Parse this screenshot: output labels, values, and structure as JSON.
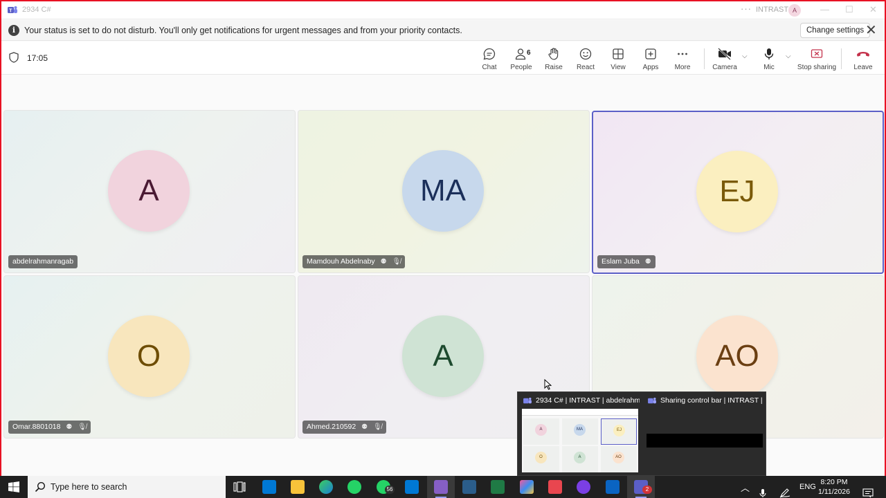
{
  "window": {
    "title": "2934 C#",
    "org": "INTRAST",
    "avatar_initial": "A"
  },
  "banner": {
    "message": "Your status is set to do not disturb. You'll only get notifications for urgent messages and from your priority contacts.",
    "change_settings": "Change settings"
  },
  "toolbar": {
    "timer": "17:05",
    "chat": "Chat",
    "people": "People",
    "people_count": "6",
    "raise": "Raise",
    "react": "React",
    "view": "View",
    "apps": "Apps",
    "more": "More",
    "camera": "Camera",
    "mic": "Mic",
    "stop_sharing": "Stop sharing",
    "leave": "Leave"
  },
  "participants": [
    {
      "initials": "A",
      "name": "abdelrahmanragab",
      "bg": "#f1d3dd",
      "fg": "#4a1a33"
    },
    {
      "initials": "MA",
      "name": "Mamdouh Abdelnaby",
      "bg": "#c7d8ec",
      "fg": "#1b2f5a"
    },
    {
      "initials": "EJ",
      "name": "Eslam Juba",
      "bg": "#fbefc0",
      "fg": "#7a5a0a"
    },
    {
      "initials": "O",
      "name": "Omar.8801018",
      "bg": "#f8e6bd",
      "fg": "#6e4d06"
    },
    {
      "initials": "A",
      "name": "Ahmed.210592",
      "bg": "#cfe3d4",
      "fg": "#1d4a2e"
    },
    {
      "initials": "AO",
      "name": "",
      "bg": "#fbe3cf",
      "fg": "#6b3f12"
    }
  ],
  "thumbnails": {
    "first_title": "2934 C# | INTRAST | abdelrahm...",
    "second_title": "Sharing control bar | INTRAST | ..."
  },
  "taskbar": {
    "search_placeholder": "Type here to search",
    "whatsapp_badge": "56",
    "teams_badge": "2",
    "language": "ENG",
    "time": "8:20 PM",
    "date": "1/11/2026"
  }
}
